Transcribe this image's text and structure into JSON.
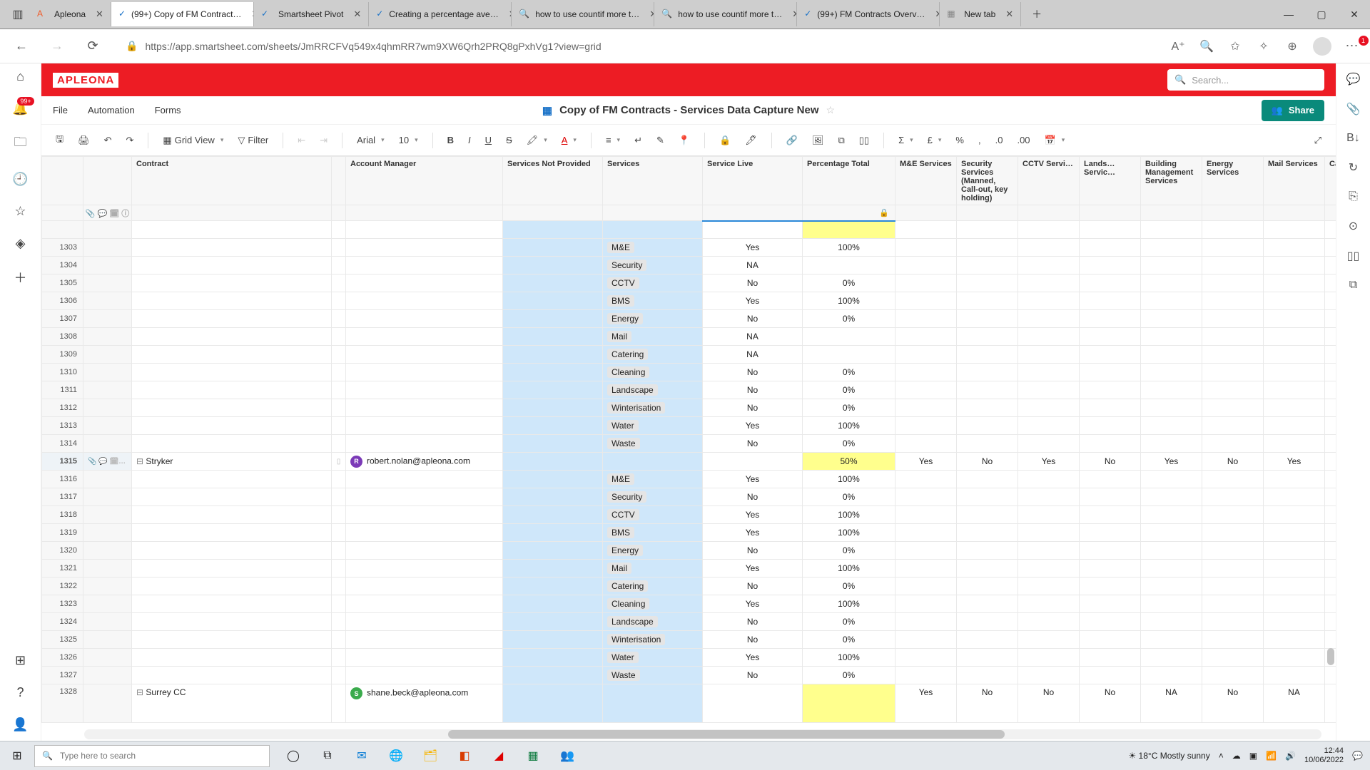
{
  "browser": {
    "tabs": [
      {
        "label": "Apleona",
        "fav": "A",
        "favColor": "#f05a28"
      },
      {
        "label": "(99+) Copy of FM Contract…",
        "fav": "✓",
        "favColor": "#1670c7",
        "active": true
      },
      {
        "label": "Smartsheet Pivot",
        "fav": "✓",
        "favColor": "#1670c7"
      },
      {
        "label": "Creating a percentage ave…",
        "fav": "✓",
        "favColor": "#1670c7"
      },
      {
        "label": "how to use countif more t…",
        "fav": "🔍",
        "favColor": "#888"
      },
      {
        "label": "how to use countif more t…",
        "fav": "🔍",
        "favColor": "#888"
      },
      {
        "label": "(99+) FM Contracts Overv…",
        "fav": "✓",
        "favColor": "#1670c7"
      },
      {
        "label": "New tab",
        "fav": "▦",
        "favColor": "#888"
      }
    ],
    "url": "https://app.smartsheet.com/sheets/JmRRCFVq549x4qhmRR7wm9XW6Qrh2PRQ8gPxhVg1?view=grid",
    "notifCount": "1"
  },
  "leftRail": {
    "notifBadge": "99+"
  },
  "brand": {
    "logo": "APLEONA",
    "searchPlaceholder": "Search..."
  },
  "menu": {
    "items": [
      "File",
      "Automation",
      "Forms"
    ],
    "title": "Copy of FM Contracts - Services Data Capture New",
    "share": "Share"
  },
  "toolbar": {
    "view": "Grid View",
    "filter": "Filter",
    "font": "Arial",
    "size": "10"
  },
  "columns": {
    "contract": "Contract",
    "account": "Account Manager",
    "snp": "Services Not Provided",
    "services": "Services",
    "live": "Service Live",
    "pct": "Percentage Total",
    "me": "M&E Services",
    "sec": "Security Services (Manned, Call-out, key holding)",
    "cctv": "CCTV Services",
    "land": "Lands… Servic…",
    "bms": "Building Management Services",
    "energy": "Energy Services",
    "mail": "Mail Services",
    "cater": "Cater Servi"
  },
  "rows": [
    {
      "num": "",
      "yellow_pct": true,
      "top_border": true
    },
    {
      "num": "1303",
      "service": "M&E",
      "live": "Yes",
      "pct": "100%"
    },
    {
      "num": "1304",
      "service": "Security",
      "live": "NA"
    },
    {
      "num": "1305",
      "service": "CCTV",
      "live": "No",
      "pct": "0%"
    },
    {
      "num": "1306",
      "service": "BMS",
      "live": "Yes",
      "pct": "100%"
    },
    {
      "num": "1307",
      "service": "Energy",
      "live": "No",
      "pct": "0%"
    },
    {
      "num": "1308",
      "service": "Mail",
      "live": "NA"
    },
    {
      "num": "1309",
      "service": "Catering",
      "live": "NA"
    },
    {
      "num": "1310",
      "service": "Cleaning",
      "live": "No",
      "pct": "0%"
    },
    {
      "num": "1311",
      "service": "Landscape",
      "live": "No",
      "pct": "0%"
    },
    {
      "num": "1312",
      "service": "Winterisation",
      "live": "No",
      "pct": "0%"
    },
    {
      "num": "1313",
      "service": "Water",
      "live": "Yes",
      "pct": "100%"
    },
    {
      "num": "1314",
      "service": "Waste",
      "live": "No",
      "pct": "0%"
    },
    {
      "num": "1315",
      "active": true,
      "contract": "Stryker",
      "handle": "⊟",
      "account": "robert.nolan@apleona.com",
      "avatar": "R",
      "avatarColor": "purple",
      "pct": "50%",
      "yellow_pct": true,
      "me": "Yes",
      "sec": "No",
      "cctv": "Yes",
      "land": "No",
      "bms": "Yes",
      "energy": "No",
      "mail": "Yes"
    },
    {
      "num": "1316",
      "service": "M&E",
      "live": "Yes",
      "pct": "100%"
    },
    {
      "num": "1317",
      "service": "Security",
      "live": "No",
      "pct": "0%"
    },
    {
      "num": "1318",
      "service": "CCTV",
      "live": "Yes",
      "pct": "100%"
    },
    {
      "num": "1319",
      "service": "BMS",
      "live": "Yes",
      "pct": "100%"
    },
    {
      "num": "1320",
      "service": "Energy",
      "live": "No",
      "pct": "0%"
    },
    {
      "num": "1321",
      "service": "Mail",
      "live": "Yes",
      "pct": "100%"
    },
    {
      "num": "1322",
      "service": "Catering",
      "live": "No",
      "pct": "0%"
    },
    {
      "num": "1323",
      "service": "Cleaning",
      "live": "Yes",
      "pct": "100%"
    },
    {
      "num": "1324",
      "service": "Landscape",
      "live": "No",
      "pct": "0%"
    },
    {
      "num": "1325",
      "service": "Winterisation",
      "live": "No",
      "pct": "0%"
    },
    {
      "num": "1326",
      "service": "Water",
      "live": "Yes",
      "pct": "100%"
    },
    {
      "num": "1327",
      "service": "Waste",
      "live": "No",
      "pct": "0%"
    },
    {
      "num": "1328",
      "contract": "Surrey CC",
      "handle": "⊟",
      "account": "shane.beck@apleona.com",
      "avatar": "S",
      "avatarColor": "green",
      "yellow_pct": true,
      "tall": true,
      "me": "Yes",
      "sec": "No",
      "cctv": "No",
      "land": "No",
      "bms": "NA",
      "energy": "No",
      "mail": "NA"
    }
  ],
  "taskbar": {
    "searchPlaceholder": "Type here to search",
    "weather": "18°C  Mostly sunny",
    "time": "12:44",
    "date": "10/06/2022"
  }
}
